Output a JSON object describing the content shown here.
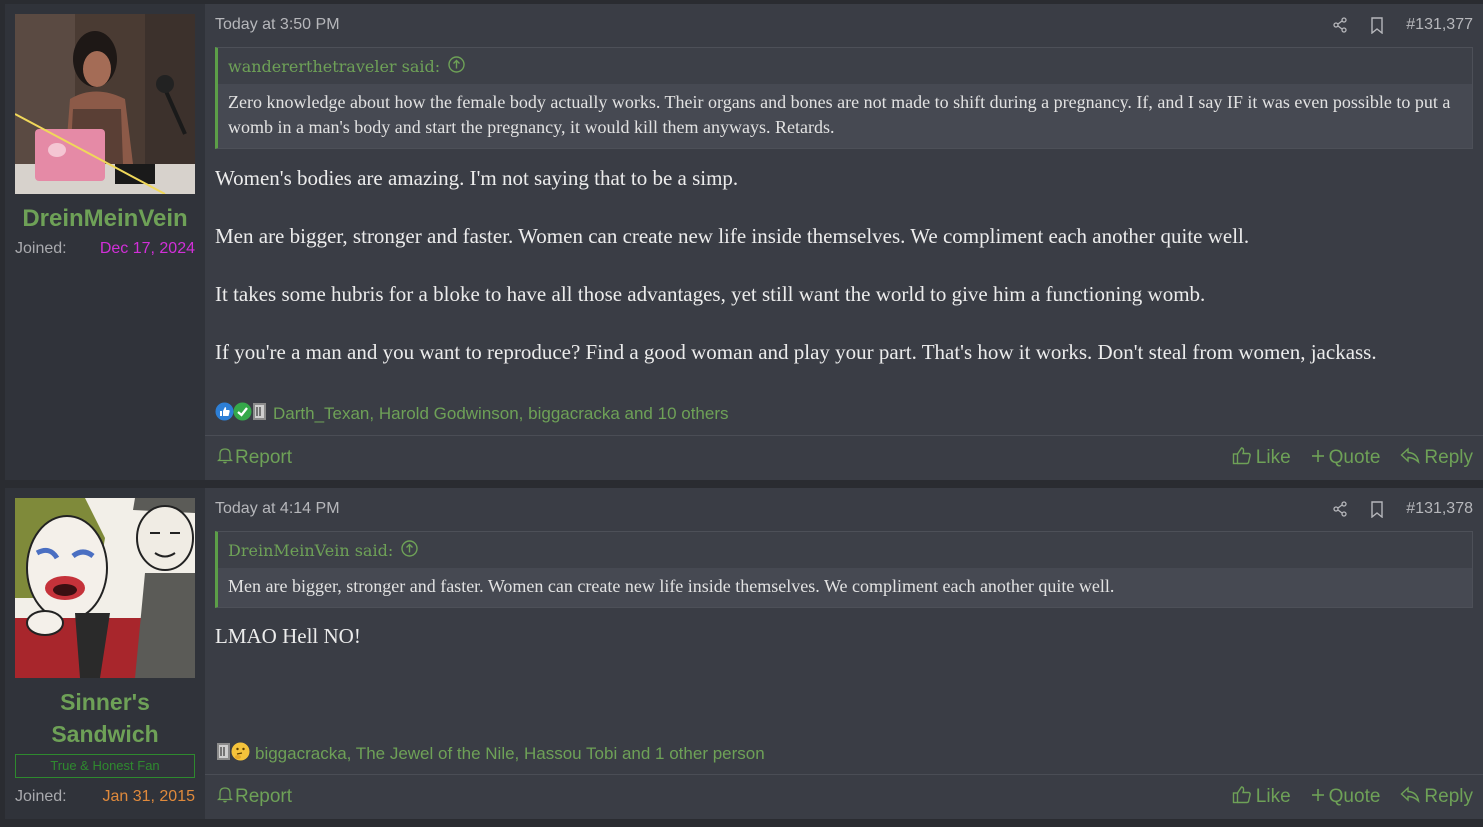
{
  "posts": [
    {
      "user": {
        "name": "DreinMeinVein",
        "joined_label": "Joined:",
        "joined_date": "Dec 17, 2024",
        "joined_color": "#d12fd8"
      },
      "timestamp": "Today at 3:50 PM",
      "post_number": "#131,377",
      "quote": {
        "author": "wandererthetraveler said:",
        "text": "Zero knowledge about how the female body actually works. Their organs and bones are not made to shift during a pregnancy. If, and I say IF it was even possible to put a womb in a man's body and start the pregnancy, it would kill them anyways. Retards."
      },
      "paragraphs": [
        "Women's bodies are amazing. I'm not saying that to be a simp.",
        "Men are bigger, stronger and faster. Women can create new life inside themselves. We compliment each another quite well.",
        "It takes some hubris for a bloke to have all those advantages, yet still want the world to give him a functioning womb.",
        "If you're a man and you want to reproduce? Find a good woman and play your part. That's how it works. Don't steal from women, jackass."
      ],
      "reactions_text": "Darth_Texan, Harold Godwinson, biggacracka and 10 others",
      "reaction_icons": [
        "like-reaction-icon",
        "checkmark-reaction-icon",
        "book-reaction-icon"
      ],
      "footer": {
        "report": "Report",
        "like": "Like",
        "quote": "Quote",
        "reply": "Reply"
      }
    },
    {
      "user": {
        "name": "Sinner's Sandwich",
        "title": "True & Honest Fan",
        "joined_label": "Joined:",
        "joined_date": "Jan 31, 2015",
        "joined_color": "#e08a3c"
      },
      "timestamp": "Today at 4:14 PM",
      "post_number": "#131,378",
      "quote": {
        "author": "DreinMeinVein said:",
        "text": "Men are bigger, stronger and faster. Women can create new life inside themselves. We compliment each another quite well."
      },
      "paragraphs": [
        "LMAO Hell NO!"
      ],
      "reactions_text": "biggacracka, The Jewel of the Nile, Hassou Tobi and 1 other person",
      "reaction_icons": [
        "book-reaction-icon",
        "thinking-reaction-icon"
      ],
      "footer": {
        "report": "Report",
        "like": "Like",
        "quote": "Quote",
        "reply": "Reply"
      }
    }
  ]
}
